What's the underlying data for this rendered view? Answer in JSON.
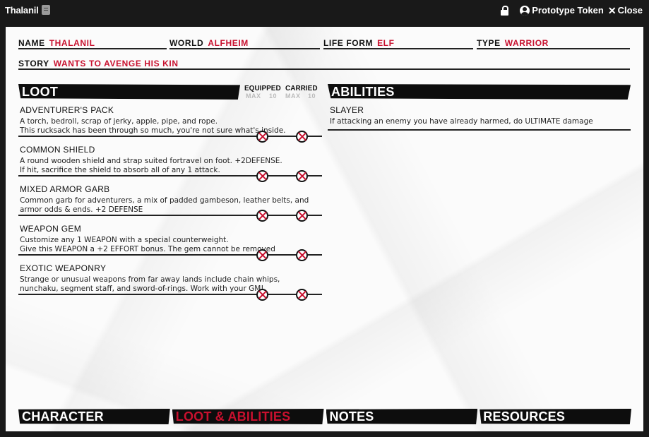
{
  "window": {
    "title": "Thalanil",
    "controls": {
      "prototype_label": "Prototype Token",
      "close_label": "Close"
    }
  },
  "header": {
    "name": {
      "label": "NAME",
      "value": "THALANIL"
    },
    "world": {
      "label": "WORLD",
      "value": "ALFHEIM"
    },
    "life_form": {
      "label": "LIFE FORM",
      "value": "ELF"
    },
    "type": {
      "label": "TYPE",
      "value": "WARRIOR"
    },
    "story": {
      "label": "STORY",
      "value": "WANTS TO AVENGE HIS KIN"
    }
  },
  "loot": {
    "title": "LOOT",
    "equipped": {
      "label": "EQUIPPED",
      "max_label": "MAX",
      "max_value": "10"
    },
    "carried": {
      "label": "CARRIED",
      "max_label": "MAX",
      "max_value": "10"
    },
    "items": [
      {
        "name": "ADVENTURER'S PACK",
        "description": "A torch, bedroll, scrap of jerky, apple, pipe, and rope.\nThis rucksack has been through so much, you're not sure what's inside."
      },
      {
        "name": "COMMON SHIELD",
        "description": "A round wooden shield and strap suited fortravel on foot. +2DEFENSE.\nIf hit, sacrifice the shield to absorb all of any 1 attack."
      },
      {
        "name": "MIXED ARMOR GARB",
        "description": "Common garb for adventurers, a mix of padded gambeson, leather belts, and\narmor odds & ends. +2 DEFENSE"
      },
      {
        "name": "WEAPON GEM",
        "description": "Customize any 1 WEAPON with a special counterweight.\nGive this WEAPON a +2 EFFORT bonus. The gem cannot be removed"
      },
      {
        "name": "EXOTIC WEAPONRY",
        "description": "Strange or unusual weapons from far away lands include chain whips,\nnunchaku, segment staff, and sword-of-rings. Work with your GM!"
      }
    ]
  },
  "abilities": {
    "title": "ABILITIES",
    "items": [
      {
        "name": "SLAYER",
        "description": "If attacking an enemy you have already harmed, do ULTIMATE damage"
      }
    ]
  },
  "tabs": [
    {
      "label": "CHARACTER",
      "active": false
    },
    {
      "label": "LOOT & ABILITIES",
      "active": true
    },
    {
      "label": "NOTES",
      "active": false
    },
    {
      "label": "RESOURCES",
      "active": false
    }
  ],
  "colors": {
    "accent": "#c8102e",
    "banner": "#0d0d0d",
    "window_bar": "#191919"
  }
}
